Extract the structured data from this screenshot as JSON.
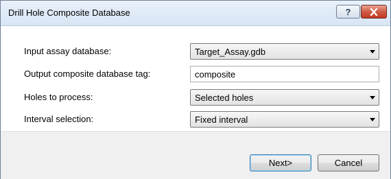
{
  "window": {
    "title": "Drill Hole Composite Database",
    "help_glyph": "?",
    "close_glyph": "✕"
  },
  "form": {
    "input_db": {
      "label": "Input assay database:",
      "value": "Target_Assay.gdb"
    },
    "output_tag": {
      "label": "Output composite database tag:",
      "value": "composite"
    },
    "holes": {
      "label": "Holes to process:",
      "value": "Selected holes"
    },
    "interval": {
      "label": "Interval selection:",
      "value": "Fixed interval"
    }
  },
  "buttons": {
    "next": "Next>",
    "cancel": "Cancel"
  },
  "colors": {
    "close_button": "#c23a22",
    "default_button_border": "#3c7fb1"
  }
}
